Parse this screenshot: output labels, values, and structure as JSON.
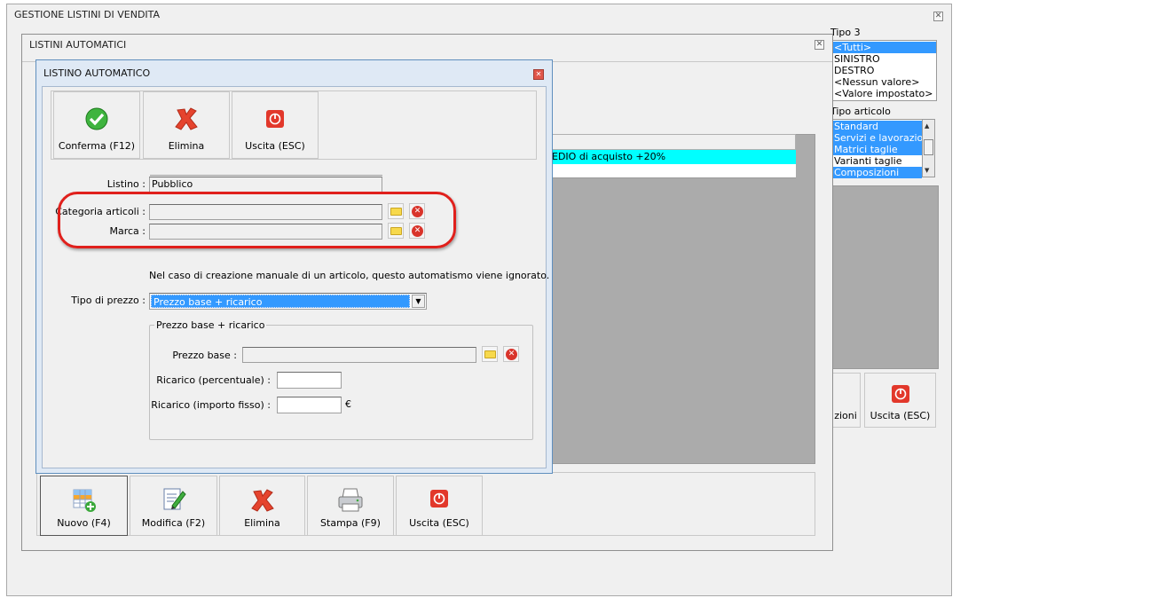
{
  "main_window": {
    "title": "GESTIONE LISTINI DI VENDITA",
    "tipo3": {
      "label": "Tipo 3",
      "items": [
        "<Tutti>",
        "SINISTRO",
        "DESTRO",
        "<Nessun valore>",
        "<Valore impostato>"
      ]
    },
    "tipo_articolo": {
      "label": "Tipo articolo",
      "items": [
        "Standard",
        "Servizi e lavorazioni",
        "Matrici taglie",
        "Varianti taglie",
        "Composizioni"
      ]
    },
    "right_buttons": {
      "partial_label": "zioni",
      "exit_label": "Uscita (ESC)"
    }
  },
  "mid_window": {
    "title": "LISTINI AUTOMATICI",
    "grid_row_text": "EDIO di acquisto +20%",
    "toolbar": {
      "new_label": "Nuovo (F4)",
      "edit_label": "Modifica (F2)",
      "delete_label": "Elimina",
      "print_label": "Stampa (F9)",
      "exit_label": "Uscita (ESC)"
    }
  },
  "dialog": {
    "title": "LISTINO AUTOMATICO",
    "toolbar": {
      "confirm_label": "Conferma (F12)",
      "delete_label": "Elimina",
      "exit_label": "Uscita (ESC)"
    },
    "listino_label": "Listino :",
    "listino_value": "Pubblico",
    "categoria_label": "Categoria articoli :",
    "categoria_value": "",
    "marca_label": "Marca :",
    "marca_value": "",
    "note": "Nel caso di creazione manuale di un articolo, questo automatismo viene ignorato.",
    "tipo_prezzo_label": "Tipo di prezzo :",
    "tipo_prezzo_value": "Prezzo base + ricarico",
    "group_title": "Prezzo base + ricarico",
    "prezzo_base_label": "Prezzo base :",
    "prezzo_base_value": "",
    "ricarico_perc_label": "Ricarico (percentuale) :",
    "ricarico_perc_value": "",
    "ricarico_fisso_label": "Ricarico (importo fisso) :",
    "ricarico_fisso_value": "",
    "currency": "€"
  },
  "colors": {
    "selection": "#3399ff",
    "highlight_row": "#00ffff",
    "annotation_red": "#e0201c"
  }
}
